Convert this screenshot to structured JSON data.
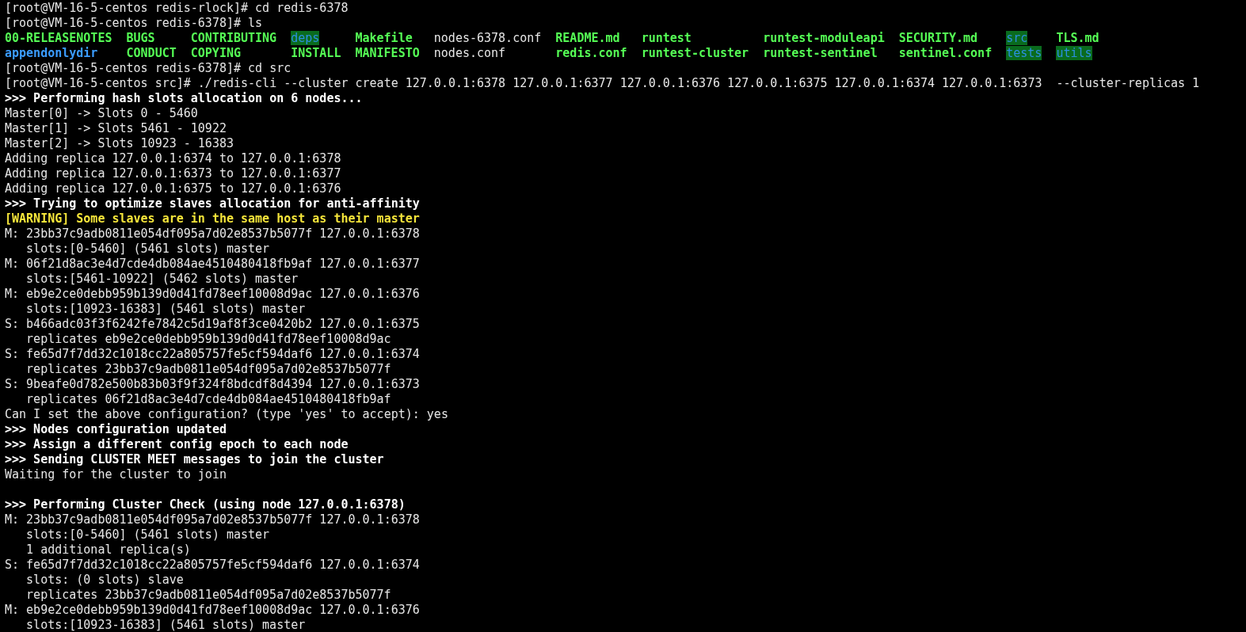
{
  "terminal": {
    "lines": [
      {
        "kind": "plain",
        "text": "[root@VM-16-5-centos redis-rlock]# cd redis-6378"
      },
      {
        "kind": "plain",
        "text": "[root@VM-16-5-centos redis-6378]# ls"
      },
      {
        "kind": "ls",
        "entries": [
          {
            "text": "00-RELEASENOTES",
            "kind": "exec"
          },
          {
            "text": "BUGS",
            "kind": "exec"
          },
          {
            "text": "CONTRIBUTING",
            "kind": "exec"
          },
          {
            "text": "deps",
            "kind": "sticky"
          },
          {
            "text": "Makefile",
            "kind": "exec"
          },
          {
            "text": "nodes-6378.conf",
            "kind": "file"
          },
          {
            "text": "README.md",
            "kind": "exec"
          },
          {
            "text": "runtest",
            "kind": "exec"
          },
          {
            "text": "runtest-moduleapi",
            "kind": "exec"
          },
          {
            "text": "SECURITY.md",
            "kind": "exec"
          },
          {
            "text": "src",
            "kind": "sticky"
          },
          {
            "text": "TLS.md",
            "kind": "exec"
          }
        ]
      },
      {
        "kind": "ls",
        "entries": [
          {
            "text": "appendonlydir",
            "kind": "dir"
          },
          {
            "text": "CONDUCT",
            "kind": "exec"
          },
          {
            "text": "COPYING",
            "kind": "exec"
          },
          {
            "text": "INSTALL",
            "kind": "exec"
          },
          {
            "text": "MANIFESTO",
            "kind": "exec"
          },
          {
            "text": "nodes.conf",
            "kind": "file"
          },
          {
            "text": "redis.conf",
            "kind": "exec"
          },
          {
            "text": "runtest-cluster",
            "kind": "exec"
          },
          {
            "text": "runtest-sentinel",
            "kind": "exec"
          },
          {
            "text": "sentinel.conf",
            "kind": "exec"
          },
          {
            "text": "tests",
            "kind": "sticky"
          },
          {
            "text": "utils",
            "kind": "sticky"
          }
        ]
      },
      {
        "kind": "plain",
        "text": "[root@VM-16-5-centos redis-6378]# cd src"
      },
      {
        "kind": "plain",
        "text": "[root@VM-16-5-centos src]# ./redis-cli --cluster create 127.0.0.1:6378 127.0.0.1:6377 127.0.0.1:6376 127.0.0.1:6375 127.0.0.1:6374 127.0.0.1:6373  --cluster-replicas 1"
      },
      {
        "kind": "bold",
        "text": ">>> Performing hash slots allocation on 6 nodes..."
      },
      {
        "kind": "plain",
        "text": "Master[0] -> Slots 0 - 5460"
      },
      {
        "kind": "plain",
        "text": "Master[1] -> Slots 5461 - 10922"
      },
      {
        "kind": "plain",
        "text": "Master[2] -> Slots 10923 - 16383"
      },
      {
        "kind": "plain",
        "text": "Adding replica 127.0.0.1:6374 to 127.0.0.1:6378"
      },
      {
        "kind": "plain",
        "text": "Adding replica 127.0.0.1:6373 to 127.0.0.1:6377"
      },
      {
        "kind": "plain",
        "text": "Adding replica 127.0.0.1:6375 to 127.0.0.1:6376"
      },
      {
        "kind": "bold",
        "text": ">>> Trying to optimize slaves allocation for anti-affinity"
      },
      {
        "kind": "warning",
        "text": "[WARNING] Some slaves are in the same host as their master"
      },
      {
        "kind": "plain",
        "text": "M: 23bb37c9adb0811e054df095a7d02e8537b5077f 127.0.0.1:6378"
      },
      {
        "kind": "indented",
        "text": "slots:[0-5460] (5461 slots) master"
      },
      {
        "kind": "plain",
        "text": "M: 06f21d8ac3e4d7cde4db084ae4510480418fb9af 127.0.0.1:6377"
      },
      {
        "kind": "indented",
        "text": "slots:[5461-10922] (5462 slots) master"
      },
      {
        "kind": "plain",
        "text": "M: eb9e2ce0debb959b139d0d41fd78eef10008d9ac 127.0.0.1:6376"
      },
      {
        "kind": "indented",
        "text": "slots:[10923-16383] (5461 slots) master"
      },
      {
        "kind": "plain",
        "text": "S: b466adc03f3f6242fe7842c5d19af8f3ce0420b2 127.0.0.1:6375"
      },
      {
        "kind": "indented",
        "text": "replicates eb9e2ce0debb959b139d0d41fd78eef10008d9ac"
      },
      {
        "kind": "plain",
        "text": "S: fe65d7f7dd32c1018cc22a805757fe5cf594daf6 127.0.0.1:6374"
      },
      {
        "kind": "indented",
        "text": "replicates 23bb37c9adb0811e054df095a7d02e8537b5077f"
      },
      {
        "kind": "plain",
        "text": "S: 9beafe0d782e500b83b03f9f324f8bdcdf8d4394 127.0.0.1:6373"
      },
      {
        "kind": "indented",
        "text": "replicates 06f21d8ac3e4d7cde4db084ae4510480418fb9af"
      },
      {
        "kind": "plain",
        "text": "Can I set the above configuration? (type 'yes' to accept): yes"
      },
      {
        "kind": "bold",
        "text": ">>> Nodes configuration updated"
      },
      {
        "kind": "bold",
        "text": ">>> Assign a different config epoch to each node"
      },
      {
        "kind": "bold",
        "text": ">>> Sending CLUSTER MEET messages to join the cluster"
      },
      {
        "kind": "plain",
        "text": "Waiting for the cluster to join"
      },
      {
        "kind": "blank"
      },
      {
        "kind": "bold",
        "text": ">>> Performing Cluster Check (using node 127.0.0.1:6378)"
      },
      {
        "kind": "plain",
        "text": "M: 23bb37c9adb0811e054df095a7d02e8537b5077f 127.0.0.1:6378"
      },
      {
        "kind": "indented",
        "text": "slots:[0-5460] (5461 slots) master"
      },
      {
        "kind": "indented",
        "text": "1 additional replica(s)"
      },
      {
        "kind": "plain",
        "text": "S: fe65d7f7dd32c1018cc22a805757fe5cf594daf6 127.0.0.1:6374"
      },
      {
        "kind": "indented",
        "text": "slots: (0 slots) slave"
      },
      {
        "kind": "indented",
        "text": "replicates 23bb37c9adb0811e054df095a7d02e8537b5077f"
      },
      {
        "kind": "plain",
        "text": "M: eb9e2ce0debb959b139d0d41fd78eef10008d9ac 127.0.0.1:6376"
      },
      {
        "kind": "indented",
        "text": "slots:[10923-16383] (5461 slots) master"
      }
    ]
  }
}
